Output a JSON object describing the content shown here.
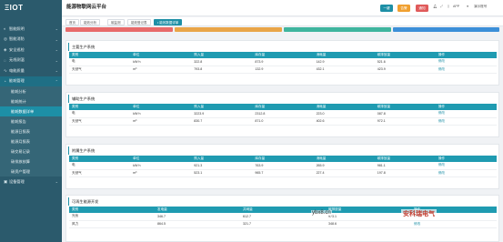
{
  "brand": {
    "logo": "ΞIOT"
  },
  "sidebar": {
    "items": [
      {
        "label": "智能照明",
        "icon": "bulb-icon"
      },
      {
        "label": "智能消防",
        "icon": "fire-icon"
      },
      {
        "label": "安全巡检",
        "icon": "shield-icon"
      },
      {
        "label": "无线测温",
        "icon": "thermo-icon"
      },
      {
        "label": "电能质量",
        "icon": "wave-icon"
      },
      {
        "label": "能耗管理",
        "icon": "gauge-icon"
      }
    ],
    "subitems": [
      {
        "label": "能耗分析"
      },
      {
        "label": "能耗统计"
      },
      {
        "label": "能耗数据详单"
      },
      {
        "label": "能耗报告"
      },
      {
        "label": "能源日报表"
      },
      {
        "label": "能源月报表"
      },
      {
        "label": "碳交易记录"
      },
      {
        "label": "碳排放核算"
      },
      {
        "label": "碳资产管理"
      }
    ],
    "bottom": {
      "label": "设备管理"
    }
  },
  "header": {
    "title": "能源物联网云平台",
    "buttons": [
      {
        "label": "一键",
        "color": "#1d8fa6"
      },
      {
        "label": "告警",
        "color": "#f0a030"
      },
      {
        "label": "通知",
        "color": "#e05a5a"
      }
    ],
    "app_label": "APP",
    "user": "演示账号"
  },
  "tabs": [
    {
      "label": "首页"
    },
    {
      "label": "能效分析"
    },
    {
      "label": "碳监测"
    },
    {
      "label": "能效登记表"
    },
    {
      "label": "• 能效数据详单"
    }
  ],
  "strip_colors": [
    "#e86a6a",
    "#e9a548",
    "#3fb59e",
    "#3c8fd8"
  ],
  "sections": [
    {
      "title": "主要生产系统",
      "headers": [
        "类别",
        "单位",
        "购入量",
        "库存量",
        "消耗量",
        "碳排放量",
        "操作"
      ],
      "rows": [
        [
          "电",
          "kW·h",
          "322.8",
          "873.9",
          "142.9",
          "521.6",
          "修改"
        ],
        [
          "天然气",
          "m³",
          "793.8",
          "132.9",
          "432.1",
          "423.9",
          "修改"
        ]
      ]
    },
    {
      "title": "辅助生产系统",
      "headers": [
        "类别",
        "单位",
        "购入量",
        "库存量",
        "消耗量",
        "碳排放量",
        "操作"
      ],
      "rows": [
        [
          "电",
          "kW·h",
          "3223.9",
          "2312.8",
          "223.0",
          "087.8",
          "修改"
        ],
        [
          "天然气",
          "m³",
          "830.7",
          "871.0",
          "402.6",
          "972.1",
          "修改"
        ]
      ]
    },
    {
      "title": "附属生产系统",
      "headers": [
        "类别",
        "单位",
        "购入量",
        "库存量",
        "消耗量",
        "碳排放量",
        "操作"
      ],
      "rows": [
        [
          "电",
          "kW·h",
          "921.3",
          "763.9",
          "265.9",
          "981.1",
          "修改"
        ],
        [
          "天然气",
          "m³",
          "523.1",
          "965.7",
          "227.4",
          "197.8",
          "修改"
        ]
      ]
    },
    {
      "title": "可再生能源开发",
      "headers": [
        "类别",
        "发电量",
        "并网量",
        "碳排放量",
        "操作"
      ],
      "rows": [
        [
          "光伏",
          "346.7",
          "612.7",
          "973.1",
          "修改"
        ],
        [
          "风力",
          "864.5",
          "321.7",
          "348.6",
          "修改"
        ]
      ]
    }
  ],
  "watermark": {
    "site": "ybx8.cn",
    "brand": "安科瑞电气"
  }
}
